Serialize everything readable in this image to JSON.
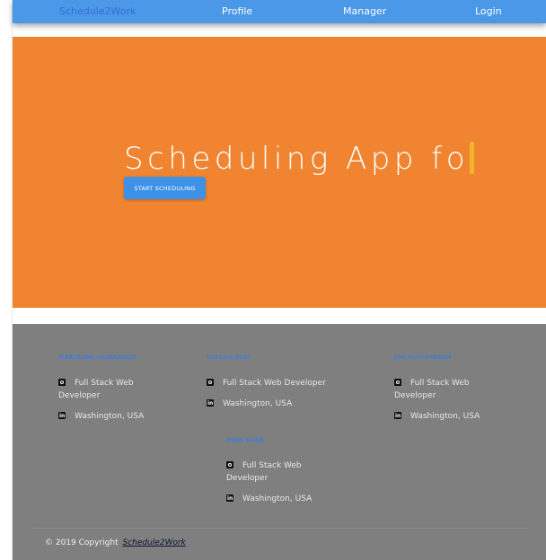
{
  "nav": {
    "brand": "Schedule2Work",
    "items": [
      {
        "label": "Profile"
      },
      {
        "label": "Manager"
      },
      {
        "label": "Login"
      }
    ]
  },
  "hero": {
    "title": "Scheduling App fo",
    "button_label": "START SCHEDULING"
  },
  "team": [
    {
      "name": "MARYANNE HEINBAUGH",
      "role": "Full Stack Web Developer",
      "location": "Washington, USA",
      "role_icon": "github-icon",
      "location_icon": "linkedin-icon"
    },
    {
      "name": "CULLAN AOKI",
      "role": "Full Stack Web Developer",
      "location": "Washington, USA",
      "role_icon": "github-icon",
      "location_icon": "linkedin-icon"
    },
    {
      "name": "JOE HUTCHINSON",
      "role": "Full Stack Web Developer",
      "location": "Washington, USA",
      "role_icon": "github-icon",
      "location_icon": "linkedin-icon"
    },
    {
      "name": "IMAN GURE",
      "role": "Full Stack Web Developer",
      "location": "Washington, USA",
      "role_icon": "github-icon",
      "location_icon": "linkedin-icon"
    }
  ],
  "footer": {
    "copyright_prefix": "© 2019 Copyright",
    "copyright_brand": "Schedule2Work"
  },
  "colors": {
    "nav_bg": "#4b97e8",
    "hero_bg": "#f08431",
    "button_bg": "#3d92e7",
    "footer_bg": "#7f7f7f",
    "caret": "#f1b429"
  }
}
